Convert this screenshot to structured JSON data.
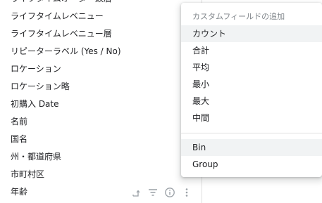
{
  "fields": [
    {
      "label": "ライフタイムオーダー数層"
    },
    {
      "label": "ライフタイムレベニュー"
    },
    {
      "label": "ライフタイムレベニュー層"
    },
    {
      "label": "リピーターラベル (Yes / No)"
    },
    {
      "label": "ロケーション"
    },
    {
      "label": "ロケーション略"
    },
    {
      "label": "初購入 Date"
    },
    {
      "label": "名前"
    },
    {
      "label": "国名"
    },
    {
      "label": "州・都道府県"
    },
    {
      "label": "市町村区"
    },
    {
      "label": "年齢"
    }
  ],
  "row_action_icons": [
    "pivot-icon",
    "filter-icon",
    "info-icon",
    "more-vert-icon"
  ],
  "menu": {
    "header": "カスタムフィールドの追加",
    "measure_items": [
      {
        "label": "カウント"
      },
      {
        "label": "合計"
      },
      {
        "label": "平均"
      },
      {
        "label": "最小"
      },
      {
        "label": "最大"
      },
      {
        "label": "中間"
      }
    ],
    "dimension_items": [
      {
        "label": "Bin"
      },
      {
        "label": "Group"
      }
    ]
  },
  "colors": {
    "text": "#202124",
    "icon": "#9aa0a6",
    "menu_header": "#80868b",
    "hover": "#f1f3f4",
    "divider": "#e0e0e0"
  }
}
